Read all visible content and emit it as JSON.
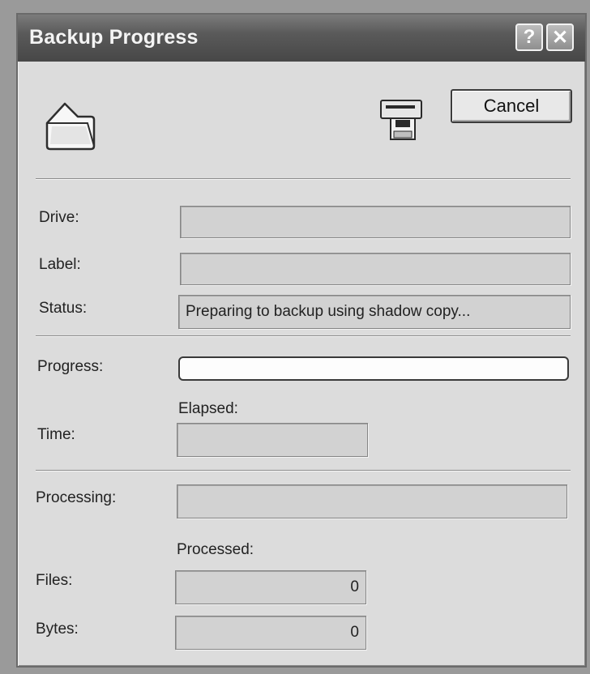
{
  "window": {
    "title": "Backup Progress",
    "help_label": "?",
    "close_label": "✕"
  },
  "icons": {
    "folder": "folder-icon",
    "floppy": "floppy-drive-icon"
  },
  "buttons": {
    "cancel": "Cancel"
  },
  "fields": {
    "drive": {
      "label": "Drive:",
      "value": ""
    },
    "label": {
      "label": "Label:",
      "value": ""
    },
    "status": {
      "label": "Status:",
      "value": "Preparing to backup using shadow copy..."
    }
  },
  "progress": {
    "label": "Progress:",
    "fraction": 0
  },
  "time": {
    "header": "Elapsed:",
    "label": "Time:",
    "value": ""
  },
  "processing": {
    "label": "Processing:",
    "value": ""
  },
  "processed": {
    "header": "Processed:",
    "files_label": "Files:",
    "files_value": "0",
    "bytes_label": "Bytes:",
    "bytes_value": "0"
  }
}
